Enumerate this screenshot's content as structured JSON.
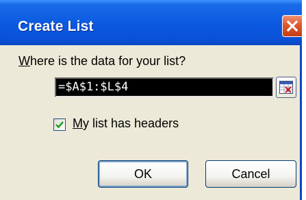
{
  "window": {
    "title": "Create List",
    "close_icon": "close-icon"
  },
  "prompt": {
    "label_accel": "W",
    "label_rest": "here is the data for your list?"
  },
  "range": {
    "value": "=$A$1:$L$4",
    "collapse_icon": "collapse-dialog-icon"
  },
  "headers_checkbox": {
    "checked": true,
    "label_accel": "M",
    "label_rest": "y list has headers"
  },
  "buttons": {
    "ok_label": "OK",
    "cancel_label": "Cancel"
  },
  "colors": {
    "titlebar": "#0b58e0",
    "dialog_bg": "#ece9d8",
    "close_button": "#e0582f",
    "checkmark": "#21a121"
  }
}
